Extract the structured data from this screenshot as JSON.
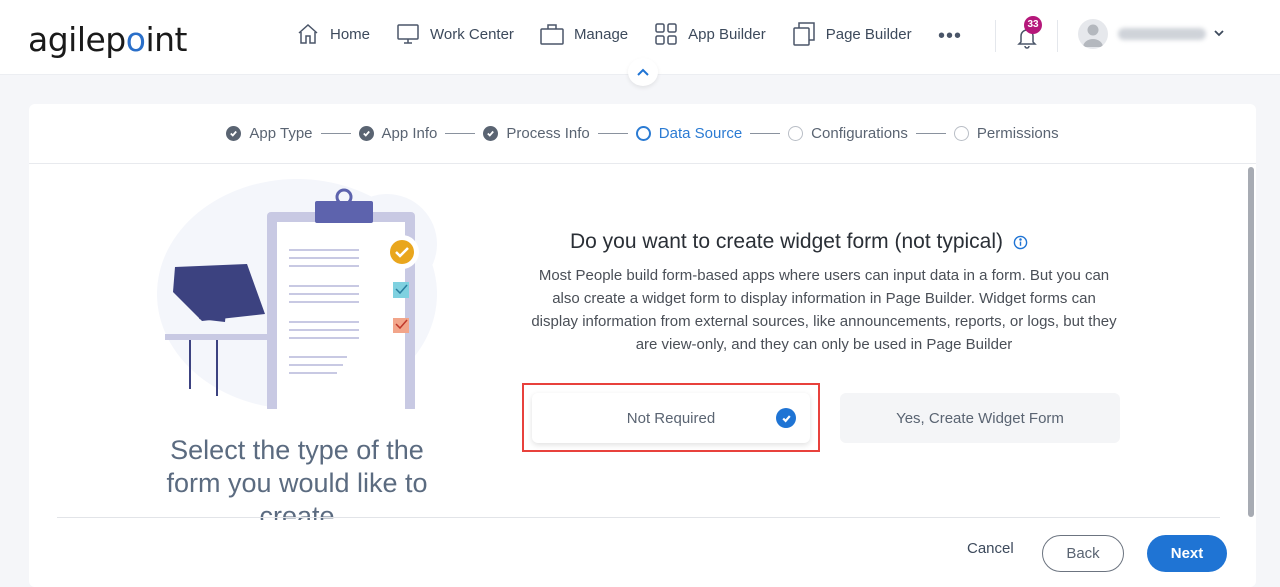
{
  "header": {
    "logo_text_a": "agilep",
    "logo_text_dot": "o",
    "logo_text_b": "int",
    "nav": [
      {
        "label": "Home",
        "icon": "home-icon"
      },
      {
        "label": "Work Center",
        "icon": "monitor-icon"
      },
      {
        "label": "Manage",
        "icon": "briefcase-icon"
      },
      {
        "label": "App Builder",
        "icon": "grid-icon"
      },
      {
        "label": "Page Builder",
        "icon": "pages-icon"
      }
    ],
    "more_label": "•••",
    "notification_count": "33"
  },
  "stepper": {
    "steps": [
      {
        "label": "App Type",
        "state": "done"
      },
      {
        "label": "App Info",
        "state": "done"
      },
      {
        "label": "Process Info",
        "state": "done"
      },
      {
        "label": "Data Source",
        "state": "active"
      },
      {
        "label": "Configurations",
        "state": "todo"
      },
      {
        "label": "Permissions",
        "state": "todo"
      }
    ]
  },
  "left": {
    "title": "Select the type of the form you would like to create"
  },
  "question": {
    "title": "Do you want to create widget form (not typical)",
    "description": "Most People build form-based apps where users can input data in a form. But you can also create a widget form to display information in Page Builder. Widget forms can display information from external sources, like announcements, reports, or logs, but they are view-only, and they can only be used in Page Builder"
  },
  "options": [
    {
      "label": "Not Required",
      "selected": true
    },
    {
      "label": "Yes, Create Widget Form",
      "selected": false
    }
  ],
  "footer": {
    "cancel_label": "Cancel",
    "back_label": "Back",
    "next_label": "Next"
  },
  "colors": {
    "accent": "#1f74d4",
    "badge": "#b5177a",
    "highlight": "#e8413c"
  }
}
